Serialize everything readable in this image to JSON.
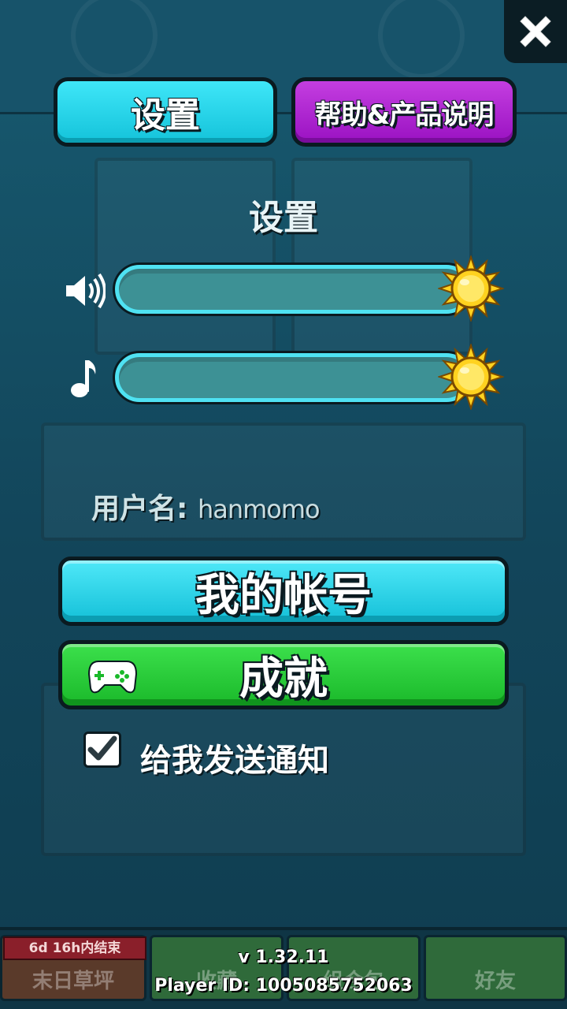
{
  "tabs": {
    "settings_label": "设置",
    "help_label": "帮助&产品说明"
  },
  "section_title": "设置",
  "sliders": {
    "sound": {
      "icon": "speaker-icon",
      "level": 1.0
    },
    "music": {
      "icon": "music-note-icon",
      "level": 1.0
    }
  },
  "user": {
    "label": "用户名:",
    "name": "hanmomo"
  },
  "buttons": {
    "account_label": "我的帐号",
    "achievements_label": "成就"
  },
  "notifications": {
    "checked": true,
    "label": "给我发送通知"
  },
  "footer": {
    "version": "v 1.32.11",
    "player_id": "Player ID: 1005085752063"
  },
  "background": {
    "banner": "6d 16h内结束",
    "tab1": "末日草坪",
    "tab2": "收藏",
    "tab3": "组合包",
    "tab4": "好友"
  },
  "colors": {
    "settings_tab": "#14c3da",
    "help_tab": "#9a12c2",
    "account_button": "#14c0d8",
    "achievements_button": "#1ab92a",
    "slider_track": "#3a8f93",
    "slider_border": "#4fe2f2",
    "sun": "#ffd21f"
  }
}
